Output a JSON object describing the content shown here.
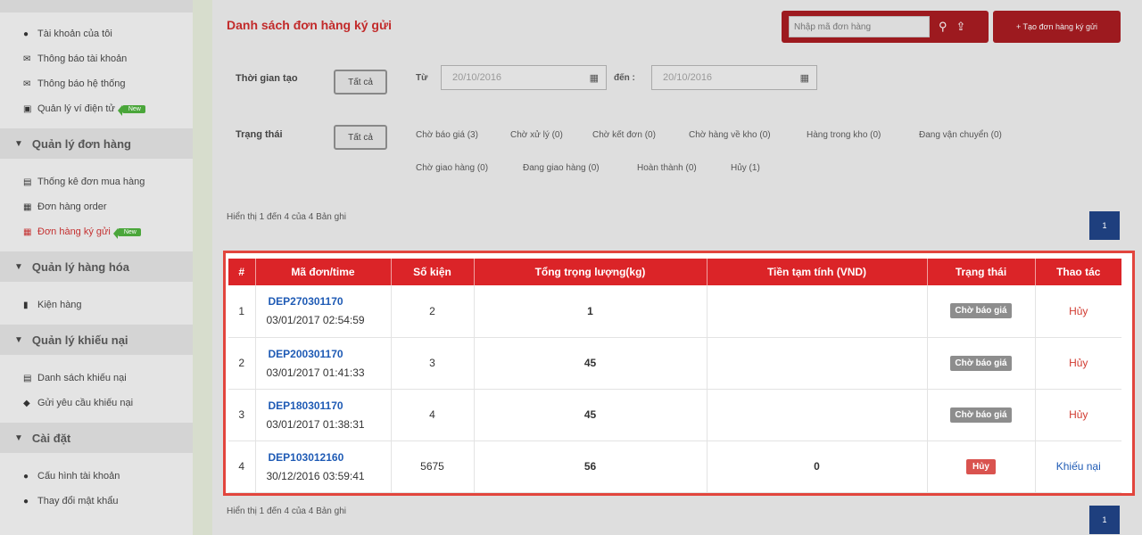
{
  "sidebar": {
    "top_items": [
      {
        "label": "Tài khoản của tôi",
        "icon": "user-icon"
      },
      {
        "label": "Thông báo tài khoản",
        "icon": "mail-icon"
      },
      {
        "label": "Thông báo hệ thống",
        "icon": "mail-icon"
      },
      {
        "label": "Quản lý ví điện tử",
        "icon": "wallet-icon",
        "badge": "New"
      }
    ],
    "groups": [
      {
        "title": "Quản lý đơn hàng",
        "items": [
          {
            "label": "Thống kê đơn mua hàng",
            "icon": "chart-icon"
          },
          {
            "label": "Đơn hàng order",
            "icon": "table-icon"
          },
          {
            "label": "Đơn hàng ký gửi",
            "icon": "table-icon",
            "badge": "New",
            "active": true
          }
        ]
      },
      {
        "title": "Quản lý hàng hóa",
        "items": [
          {
            "label": "Kiện hàng",
            "icon": "box-icon"
          }
        ]
      },
      {
        "title": "Quản lý khiếu nại",
        "items": [
          {
            "label": "Danh sách khiếu nại",
            "icon": "list-icon"
          },
          {
            "label": "Gửi yêu cầu khiếu nại",
            "icon": "send-icon"
          }
        ]
      },
      {
        "title": "Cài đặt",
        "items": [
          {
            "label": "Cấu hình tài khoản",
            "icon": "gear-icon"
          },
          {
            "label": "Thay đổi mật khẩu",
            "icon": "lock-icon"
          }
        ]
      }
    ]
  },
  "header": {
    "title": "Danh sách đơn hàng ký gửi",
    "search_placeholder": "Nhập mã đơn hàng",
    "create_label": "+ Tạo đơn hàng ký gửi"
  },
  "filters": {
    "created_label": "Thời gian tạo",
    "all_label": "Tất cả",
    "from_label": "Từ",
    "from_value": "20/10/2016",
    "to_label": "đến :",
    "to_value": "20/10/2016",
    "status_label": "Trạng thái",
    "statuses": [
      "Chờ báo giá (3)",
      "Chờ xử lý (0)",
      "Chờ kết đơn (0)",
      "Chờ hàng về kho (0)",
      "Hàng trong kho (0)",
      "Đang vận chuyển (0)",
      "Chờ giao hàng (0)",
      "Đang giao hàng (0)",
      "Hoàn thành (0)",
      "Hủy (1)"
    ]
  },
  "records_info": "Hiển thị 1 đến 4 của 4 Bản ghi",
  "pagination": {
    "current": "1"
  },
  "table": {
    "headers": [
      "#",
      "Mã đơn/time",
      "Số kiện",
      "Tổng trọng lượng(kg)",
      "Tiền tạm tính (VND)",
      "Trạng thái",
      "Thao tác"
    ],
    "rows": [
      {
        "index": "1",
        "code": "DEP270301170",
        "time": "03/01/2017 02:54:59",
        "packages": "2",
        "weight": "1",
        "amount": "",
        "status": "Chờ báo giá",
        "status_type": "grey",
        "action": "Hủy",
        "action_type": "cancel"
      },
      {
        "index": "2",
        "code": "DEP200301170",
        "time": "03/01/2017 01:41:33",
        "packages": "3",
        "weight": "45",
        "amount": "",
        "status": "Chờ báo giá",
        "status_type": "grey",
        "action": "Hủy",
        "action_type": "cancel"
      },
      {
        "index": "3",
        "code": "DEP180301170",
        "time": "03/01/2017 01:38:31",
        "packages": "4",
        "weight": "45",
        "amount": "",
        "status": "Chờ báo giá",
        "status_type": "grey",
        "action": "Hủy",
        "action_type": "cancel"
      },
      {
        "index": "4",
        "code": "DEP103012160",
        "time": "30/12/2016 03:59:41",
        "packages": "5675",
        "weight": "56",
        "amount": "0",
        "status": "Hủy",
        "status_type": "red",
        "action": "Khiếu nại",
        "action_type": "complain"
      }
    ]
  },
  "colors": {
    "accent": "#db2428",
    "dark_red": "#9d1a1f",
    "link": "#1f5bb5",
    "highlight_border": "#e2453d"
  }
}
